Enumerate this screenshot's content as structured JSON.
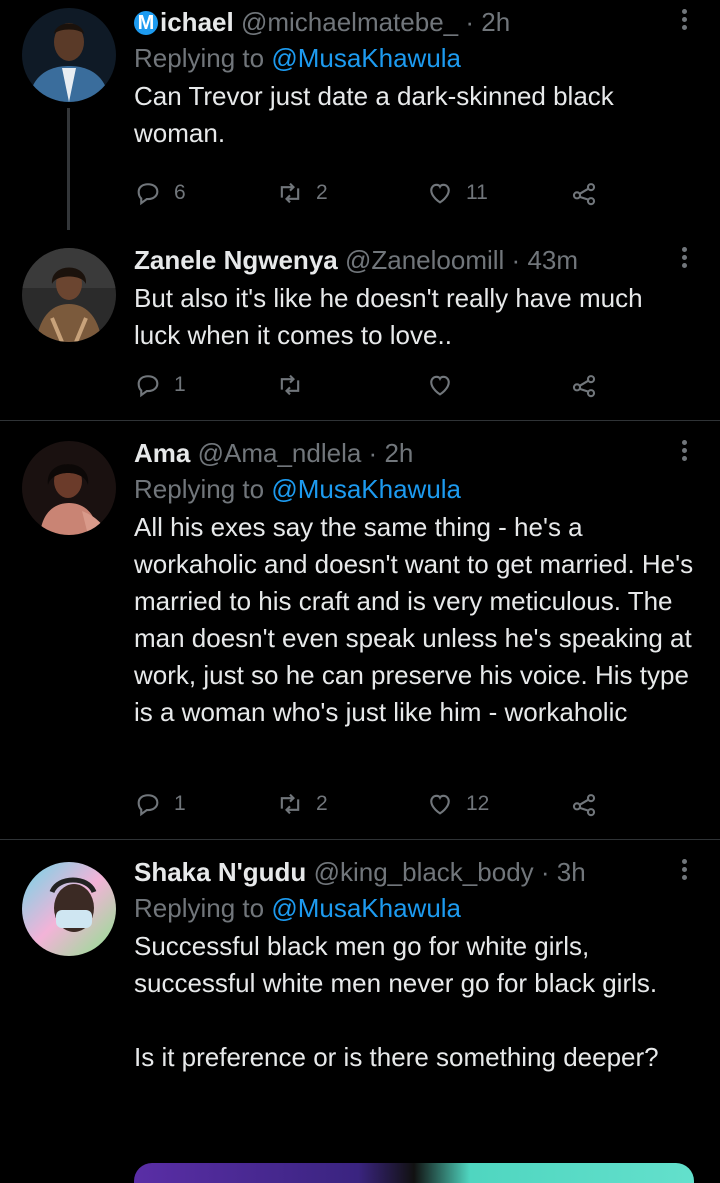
{
  "tweets": [
    {
      "name": "ichael",
      "name_badge": "M",
      "handle": "@michaelmatebe_",
      "time": "2h",
      "replying_prefix": "Replying to",
      "replying_to": "@MusaKhawula",
      "text": "Can Trevor just date a dark-skinned black woman.",
      "replies": "6",
      "retweets": "2",
      "likes": "11",
      "avatar_colors": [
        "#1c3550",
        "#3a6d9c",
        "#c9d6e3"
      ]
    },
    {
      "name": "Zanele Ngwenya",
      "handle": "@Zaneloomill",
      "time": "43m",
      "text": "But also it's like he doesn't really have much luck when it comes to love..",
      "replies": "1",
      "retweets": "",
      "likes": "",
      "avatar_colors": [
        "#2b2b2b",
        "#7b5a3c",
        "#c8a27a"
      ]
    },
    {
      "name": "Ama",
      "handle": "@Ama_ndlela",
      "time": "2h",
      "replying_prefix": "Replying to",
      "replying_to": "@MusaKhawula",
      "text": "All his exes say the same thing - he's a workaholic and doesn't want to get married. He's married to his craft and is very meticulous. The man doesn't even speak unless he's speaking at work, just so he can preserve his voice. His type is a woman who's just like him - workaholic",
      "replies": "1",
      "retweets": "2",
      "likes": "12",
      "avatar_colors": [
        "#1a1110",
        "#6b3b2a",
        "#d99a8a"
      ]
    },
    {
      "name": "Shaka N'gudu",
      "handle": "@king_black_body",
      "time": "3h",
      "replying_prefix": "Replying to",
      "replying_to": "@MusaKhawula",
      "text": "Successful black men go for white girls, successful white men never go for black girls.\n\nIs it preference or is there something deeper?",
      "avatar_colors": [
        "#6fd6e8",
        "#f3b3d8",
        "#8be38c"
      ]
    }
  ],
  "separator": "·",
  "icons": {
    "reply": "reply-icon",
    "retweet": "retweet-icon",
    "like": "heart-icon",
    "share": "share-icon",
    "more": "more-icon"
  },
  "colors": {
    "background": "#000000",
    "text": "#e7e9ea",
    "secondary": "#71767b",
    "link": "#1d9bf0",
    "divider": "#2f3336"
  }
}
